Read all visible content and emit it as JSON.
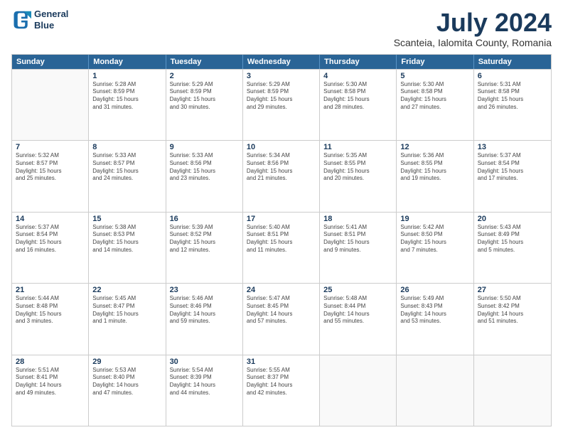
{
  "logo": {
    "line1": "General",
    "line2": "Blue"
  },
  "title": "July 2024",
  "subtitle": "Scanteia, Ialomita County, Romania",
  "days_of_week": [
    "Sunday",
    "Monday",
    "Tuesday",
    "Wednesday",
    "Thursday",
    "Friday",
    "Saturday"
  ],
  "weeks": [
    [
      {
        "day": "",
        "info": ""
      },
      {
        "day": "1",
        "info": "Sunrise: 5:28 AM\nSunset: 8:59 PM\nDaylight: 15 hours\nand 31 minutes."
      },
      {
        "day": "2",
        "info": "Sunrise: 5:29 AM\nSunset: 8:59 PM\nDaylight: 15 hours\nand 30 minutes."
      },
      {
        "day": "3",
        "info": "Sunrise: 5:29 AM\nSunset: 8:59 PM\nDaylight: 15 hours\nand 29 minutes."
      },
      {
        "day": "4",
        "info": "Sunrise: 5:30 AM\nSunset: 8:58 PM\nDaylight: 15 hours\nand 28 minutes."
      },
      {
        "day": "5",
        "info": "Sunrise: 5:30 AM\nSunset: 8:58 PM\nDaylight: 15 hours\nand 27 minutes."
      },
      {
        "day": "6",
        "info": "Sunrise: 5:31 AM\nSunset: 8:58 PM\nDaylight: 15 hours\nand 26 minutes."
      }
    ],
    [
      {
        "day": "7",
        "info": "Sunrise: 5:32 AM\nSunset: 8:57 PM\nDaylight: 15 hours\nand 25 minutes."
      },
      {
        "day": "8",
        "info": "Sunrise: 5:33 AM\nSunset: 8:57 PM\nDaylight: 15 hours\nand 24 minutes."
      },
      {
        "day": "9",
        "info": "Sunrise: 5:33 AM\nSunset: 8:56 PM\nDaylight: 15 hours\nand 23 minutes."
      },
      {
        "day": "10",
        "info": "Sunrise: 5:34 AM\nSunset: 8:56 PM\nDaylight: 15 hours\nand 21 minutes."
      },
      {
        "day": "11",
        "info": "Sunrise: 5:35 AM\nSunset: 8:55 PM\nDaylight: 15 hours\nand 20 minutes."
      },
      {
        "day": "12",
        "info": "Sunrise: 5:36 AM\nSunset: 8:55 PM\nDaylight: 15 hours\nand 19 minutes."
      },
      {
        "day": "13",
        "info": "Sunrise: 5:37 AM\nSunset: 8:54 PM\nDaylight: 15 hours\nand 17 minutes."
      }
    ],
    [
      {
        "day": "14",
        "info": "Sunrise: 5:37 AM\nSunset: 8:54 PM\nDaylight: 15 hours\nand 16 minutes."
      },
      {
        "day": "15",
        "info": "Sunrise: 5:38 AM\nSunset: 8:53 PM\nDaylight: 15 hours\nand 14 minutes."
      },
      {
        "day": "16",
        "info": "Sunrise: 5:39 AM\nSunset: 8:52 PM\nDaylight: 15 hours\nand 12 minutes."
      },
      {
        "day": "17",
        "info": "Sunrise: 5:40 AM\nSunset: 8:51 PM\nDaylight: 15 hours\nand 11 minutes."
      },
      {
        "day": "18",
        "info": "Sunrise: 5:41 AM\nSunset: 8:51 PM\nDaylight: 15 hours\nand 9 minutes."
      },
      {
        "day": "19",
        "info": "Sunrise: 5:42 AM\nSunset: 8:50 PM\nDaylight: 15 hours\nand 7 minutes."
      },
      {
        "day": "20",
        "info": "Sunrise: 5:43 AM\nSunset: 8:49 PM\nDaylight: 15 hours\nand 5 minutes."
      }
    ],
    [
      {
        "day": "21",
        "info": "Sunrise: 5:44 AM\nSunset: 8:48 PM\nDaylight: 15 hours\nand 3 minutes."
      },
      {
        "day": "22",
        "info": "Sunrise: 5:45 AM\nSunset: 8:47 PM\nDaylight: 15 hours\nand 1 minute."
      },
      {
        "day": "23",
        "info": "Sunrise: 5:46 AM\nSunset: 8:46 PM\nDaylight: 14 hours\nand 59 minutes."
      },
      {
        "day": "24",
        "info": "Sunrise: 5:47 AM\nSunset: 8:45 PM\nDaylight: 14 hours\nand 57 minutes."
      },
      {
        "day": "25",
        "info": "Sunrise: 5:48 AM\nSunset: 8:44 PM\nDaylight: 14 hours\nand 55 minutes."
      },
      {
        "day": "26",
        "info": "Sunrise: 5:49 AM\nSunset: 8:43 PM\nDaylight: 14 hours\nand 53 minutes."
      },
      {
        "day": "27",
        "info": "Sunrise: 5:50 AM\nSunset: 8:42 PM\nDaylight: 14 hours\nand 51 minutes."
      }
    ],
    [
      {
        "day": "28",
        "info": "Sunrise: 5:51 AM\nSunset: 8:41 PM\nDaylight: 14 hours\nand 49 minutes."
      },
      {
        "day": "29",
        "info": "Sunrise: 5:53 AM\nSunset: 8:40 PM\nDaylight: 14 hours\nand 47 minutes."
      },
      {
        "day": "30",
        "info": "Sunrise: 5:54 AM\nSunset: 8:39 PM\nDaylight: 14 hours\nand 44 minutes."
      },
      {
        "day": "31",
        "info": "Sunrise: 5:55 AM\nSunset: 8:37 PM\nDaylight: 14 hours\nand 42 minutes."
      },
      {
        "day": "",
        "info": ""
      },
      {
        "day": "",
        "info": ""
      },
      {
        "day": "",
        "info": ""
      }
    ]
  ]
}
